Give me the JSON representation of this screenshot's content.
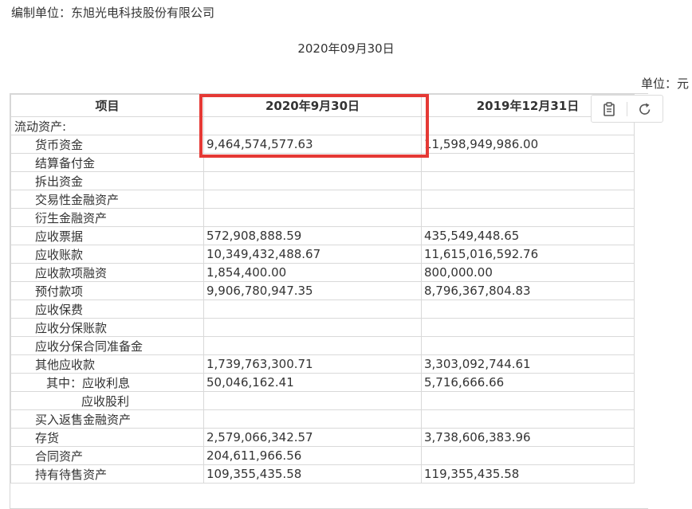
{
  "header": {
    "unit_label": "编制单位：东旭光电科技股份有限公司",
    "report_date": "2020年09月30日",
    "currency": "单位：元"
  },
  "table": {
    "columns": [
      "项目",
      "2020年9月30日",
      "2019年12月31日"
    ],
    "rows": [
      {
        "item": "流动资产:",
        "v1": "",
        "v2": "",
        "indent": 0
      },
      {
        "item": "货币资金",
        "v1": "9,464,574,577.63",
        "v2": "11,598,949,986.00",
        "indent": 1
      },
      {
        "item": "结算备付金",
        "v1": "",
        "v2": "",
        "indent": 1
      },
      {
        "item": "拆出资金",
        "v1": "",
        "v2": "",
        "indent": 1
      },
      {
        "item": "交易性金融资产",
        "v1": "",
        "v2": "",
        "indent": 1
      },
      {
        "item": "衍生金融资产",
        "v1": "",
        "v2": "",
        "indent": 1
      },
      {
        "item": "应收票据",
        "v1": "572,908,888.59",
        "v2": "435,549,448.65",
        "indent": 1
      },
      {
        "item": "应收账款",
        "v1": "10,349,432,488.67",
        "v2": "11,615,016,592.76",
        "indent": 1
      },
      {
        "item": "应收款项融资",
        "v1": "1,854,400.00",
        "v2": "800,000.00",
        "indent": 1
      },
      {
        "item": "预付款项",
        "v1": "9,906,780,947.35",
        "v2": "8,796,367,804.83",
        "indent": 1
      },
      {
        "item": "应收保费",
        "v1": "",
        "v2": "",
        "indent": 1
      },
      {
        "item": "应收分保账款",
        "v1": "",
        "v2": "",
        "indent": 1
      },
      {
        "item": "应收分保合同准备金",
        "v1": "",
        "v2": "",
        "indent": 1
      },
      {
        "item": "其他应收款",
        "v1": "1,739,763,300.71",
        "v2": "3,303,092,744.61",
        "indent": 1
      },
      {
        "item": "其中：应收利息",
        "v1": "50,046,162.41",
        "v2": "5,716,666.66",
        "indent": 2
      },
      {
        "item": "应收股利",
        "v1": "",
        "v2": "",
        "indent": 3
      },
      {
        "item": "买入返售金融资产",
        "v1": "",
        "v2": "",
        "indent": 1
      },
      {
        "item": "存货",
        "v1": "2,579,066,342.57",
        "v2": "3,738,606,383.96",
        "indent": 1
      },
      {
        "item": "合同资产",
        "v1": "204,611,966.56",
        "v2": "",
        "indent": 1
      },
      {
        "item": "持有待售资产",
        "v1": "109,355,435.58",
        "v2": "119,355,435.58",
        "indent": 1
      }
    ]
  },
  "toolbar": {
    "copy_icon": "clipboard-icon",
    "refresh_icon": "refresh-icon"
  },
  "colors": {
    "highlight": "#e53935",
    "grid": "#d9d9d9",
    "text": "#333333"
  }
}
